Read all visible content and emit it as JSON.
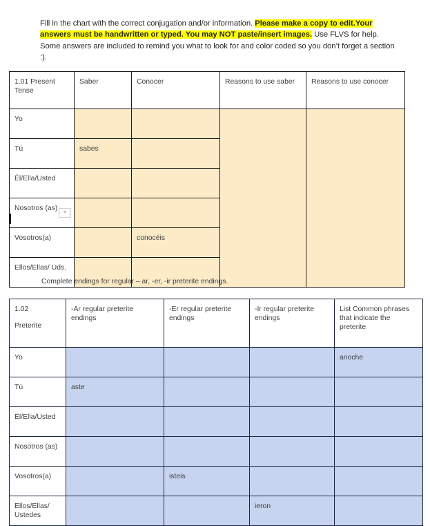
{
  "intro": {
    "line1_plain": "Fill in the chart with the correct conjugation and/or information. ",
    "line1_hl": "Please make a copy to edit.",
    "line2_hl": "Your answers must be handwritten or typed. You may NOT paste/insert images.",
    "line2_plain": " Use FLVS for help. Some answers are included to remind you what to look for and color coded so you don’t forget a section :)."
  },
  "mid_note": "Complete endings for regular – ar, -er, -ir preterite endings.",
  "colors": {
    "highlight": "#FFFF00",
    "present_fill": "#FDEBC8",
    "preterite_fill": "#C6D4F0",
    "present_border": "#1A1A1A",
    "preterite_border": "#1C2541",
    "text": "#3F3F3F"
  },
  "table_present": {
    "headers": [
      "1.01 Present Tense",
      "Saber",
      "Conocer",
      "Reasons to use saber",
      "Reasons to use conocer"
    ],
    "rows": [
      {
        "pronoun": "Yo",
        "saber": "",
        "conocer": ""
      },
      {
        "pronoun": "Tú",
        "saber": "sabes",
        "conocer": ""
      },
      {
        "pronoun": "Él/Ella/Usted",
        "saber": "",
        "conocer": ""
      },
      {
        "pronoun": "Nosotros (as)",
        "saber": "",
        "conocer": ""
      },
      {
        "pronoun": "Vosotros(a)",
        "saber": "",
        "conocer": "conocéis"
      },
      {
        "pronoun": "Ellos/Ellas/ Uds.",
        "saber": "",
        "conocer": ""
      }
    ],
    "reasons_saber": "",
    "reasons_conocer": ""
  },
  "table_preterite": {
    "headers": [
      {
        "l1": "1.02",
        "l2": "Preterite"
      },
      {
        "l1": "-Ar regular preterite endings",
        "l2": ""
      },
      {
        "l1": "-Er regular preterite endings",
        "l2": ""
      },
      {
        "l1": "-Ir regular preterite endings",
        "l2": ""
      },
      {
        "l1": "List Common phrases that indicate the preterite",
        "l2": ""
      }
    ],
    "rows": [
      {
        "pronoun": "Yo",
        "ar": "",
        "er": "",
        "ir": "",
        "phrases": "anoche"
      },
      {
        "pronoun": "Tú",
        "ar": "aste",
        "er": "",
        "ir": "",
        "phrases": ""
      },
      {
        "pronoun": "Él/Ella/Usted",
        "ar": "",
        "er": "",
        "ir": "",
        "phrases": ""
      },
      {
        "pronoun": "Nosotros (as)",
        "ar": "",
        "er": "",
        "ir": "",
        "phrases": ""
      },
      {
        "pronoun": "Vosotros(a)",
        "ar": "",
        "er": "isteis",
        "ir": "",
        "phrases": ""
      },
      {
        "pronoun": "Ellos/Ellas/ Ustedes",
        "ar": "",
        "er": "",
        "ir": "ieron",
        "phrases": ""
      }
    ]
  },
  "artifacts": {
    "cell_handle_glyph": "▾"
  }
}
